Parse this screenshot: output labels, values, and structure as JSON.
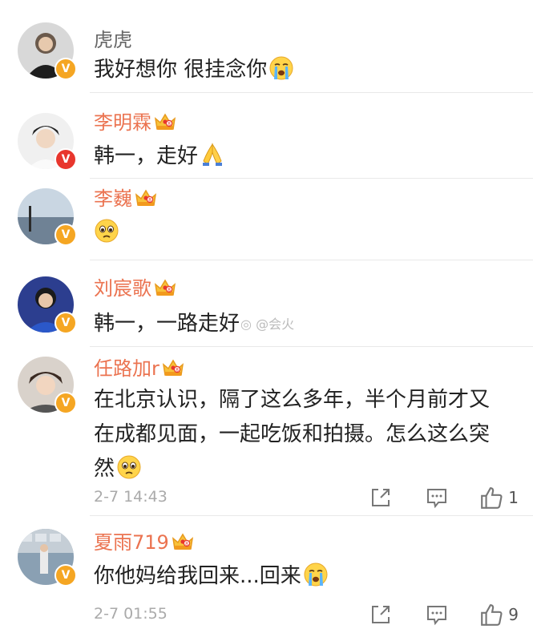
{
  "comments": [
    {
      "name": "虎虎",
      "text": "我好想你 很挂念你"
    },
    {
      "name": "李明霖",
      "text": "韩一，走好"
    },
    {
      "name": "李巍",
      "text": ""
    },
    {
      "name": "刘宸歌",
      "text": "韩一，一路走好"
    },
    {
      "name": "任路加r",
      "text_line1": "在北京认识，隔了这么多年，半个月前才又",
      "text_line2": "在成都见面，一起吃饭和拍摄。怎么这么突",
      "text_line3": "然",
      "time": "2-7 14:43",
      "likes": "1"
    },
    {
      "name": "夏雨719",
      "text": "你他妈给我回来...回来",
      "time": "2-7 01:55",
      "likes": "9"
    }
  ],
  "watermark": "@会火",
  "icons": [
    "crying-emoji",
    "pray-emoji",
    "sad-emoji",
    "crown-icon",
    "verified-badge-icon",
    "share-icon",
    "comment-icon",
    "like-icon"
  ],
  "colors": {
    "name_vip": "#eb7350",
    "name_plain": "#666666",
    "badge_gold": "#f5a623",
    "badge_red": "#e8362d",
    "meta": "#aaaaaa"
  }
}
